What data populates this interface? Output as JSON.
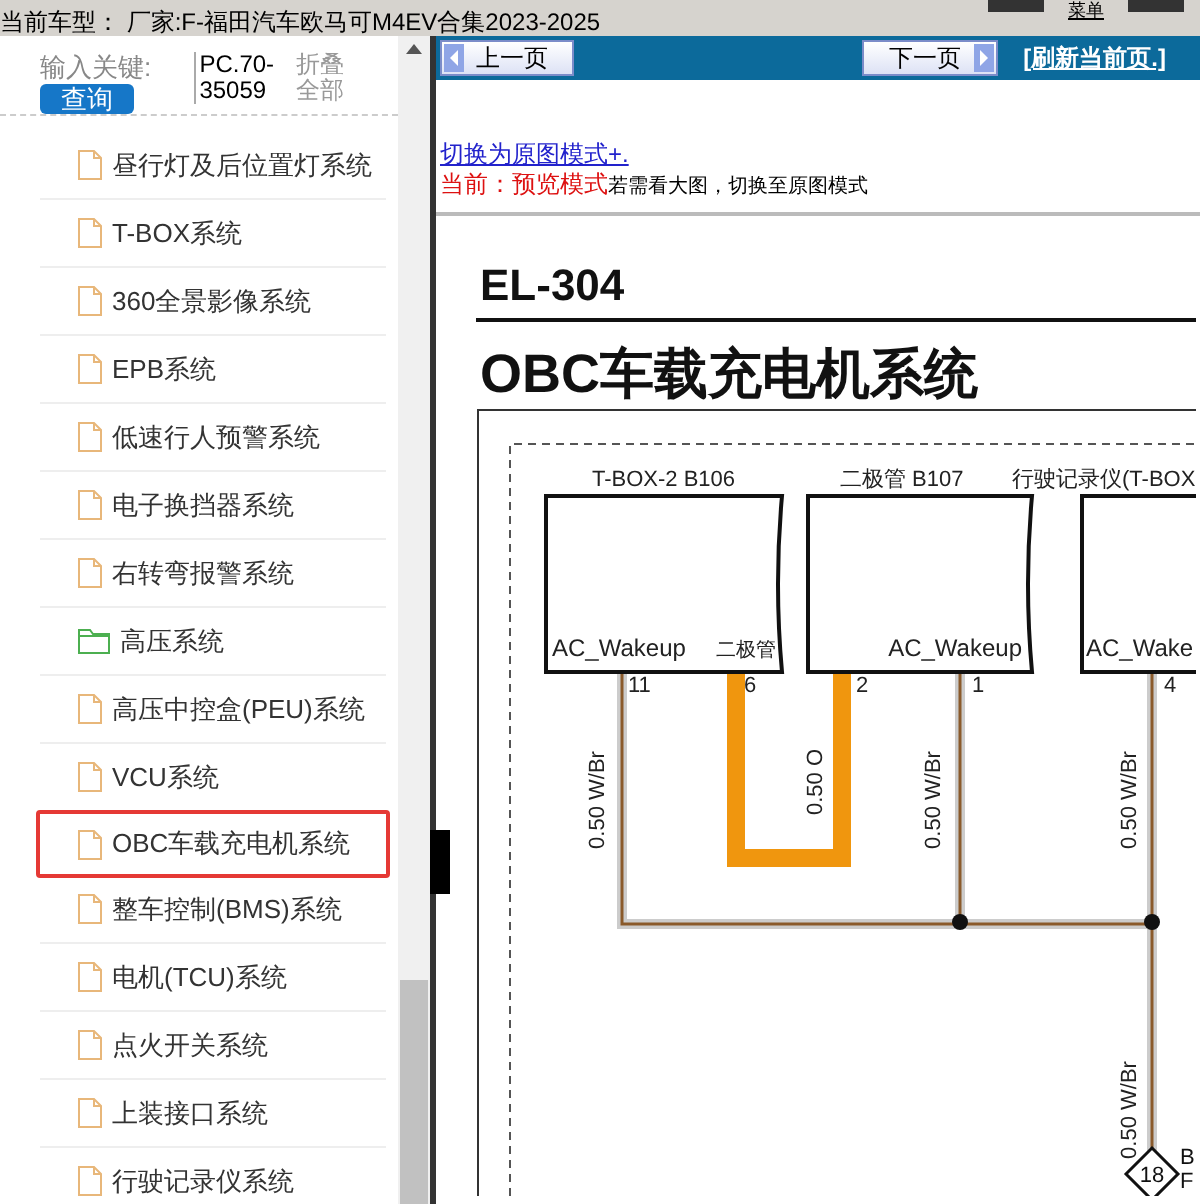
{
  "top_bar": {
    "vehicle_text": "当前车型： 厂家:F-福田汽车欧马可M4EV合集2023-2025",
    "menu_label": "菜单"
  },
  "search": {
    "label": "输入关键:",
    "button": "查询",
    "code": "PC.70-35059",
    "collapse": "折叠全部"
  },
  "sidebar": {
    "items": [
      {
        "label": "昼行灯及后位置灯系统",
        "kind": "file",
        "selected": false
      },
      {
        "label": "T-BOX系统",
        "kind": "file",
        "selected": false
      },
      {
        "label": "360全景影像系统",
        "kind": "file",
        "selected": false
      },
      {
        "label": "EPB系统",
        "kind": "file",
        "selected": false
      },
      {
        "label": "低速行人预警系统",
        "kind": "file",
        "selected": false
      },
      {
        "label": "电子换挡器系统",
        "kind": "file",
        "selected": false
      },
      {
        "label": "右转弯报警系统",
        "kind": "file",
        "selected": false
      },
      {
        "label": "高压系统",
        "kind": "folder",
        "selected": false
      },
      {
        "label": "高压中控盒(PEU)系统",
        "kind": "file",
        "selected": false
      },
      {
        "label": "VCU系统",
        "kind": "file",
        "selected": false
      },
      {
        "label": "OBC车载充电机系统",
        "kind": "file",
        "selected": true
      },
      {
        "label": "整车控制(BMS)系统",
        "kind": "file",
        "selected": false
      },
      {
        "label": "电机(TCU)系统",
        "kind": "file",
        "selected": false
      },
      {
        "label": "点火开关系统",
        "kind": "file",
        "selected": false
      },
      {
        "label": "上装接口系统",
        "kind": "file",
        "selected": false
      },
      {
        "label": "行驶记录仪系统",
        "kind": "file",
        "selected": false
      }
    ]
  },
  "toolbar": {
    "prev": "上一页",
    "next": "下一页",
    "refresh": "[刷新当前页.]"
  },
  "mode": {
    "switch_link": "切换为原图模式+.",
    "current_label": "当前：预览模式",
    "hint": "若需看大图，切换至原图模式"
  },
  "diagram": {
    "code": "EL-304",
    "title": "OBC车载充电机系统",
    "connectors": [
      {
        "label": "T-BOX-2 B106",
        "pins": [
          "AC_Wakeup",
          "二极管"
        ]
      },
      {
        "label": "二极管 B107",
        "pins": [
          "AC_Wakeup"
        ]
      },
      {
        "label": "行驶记录仪(T-BOX",
        "pins": [
          "AC_Wake"
        ]
      }
    ],
    "pin_numbers": [
      "11",
      "6",
      "2",
      "1",
      "4"
    ],
    "wire_labels": [
      "0.50 W/Br",
      "0.50 O",
      "0.50 W/Br",
      "0.50 W/Br",
      "0.50 W/Br"
    ],
    "ground": {
      "number": "18",
      "side_texts": [
        "B",
        "F"
      ]
    }
  }
}
